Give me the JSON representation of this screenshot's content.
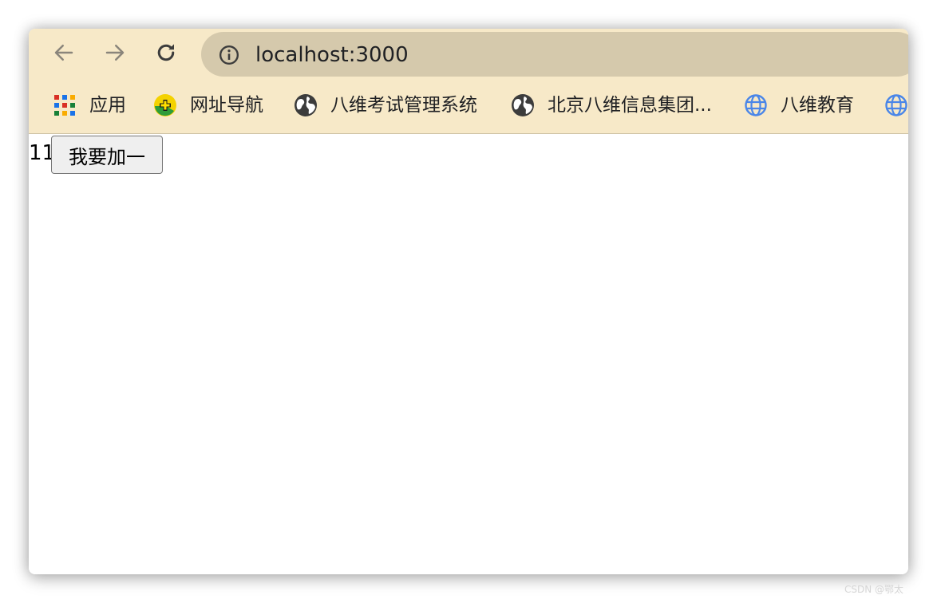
{
  "browser": {
    "url": "localhost:3000",
    "icons": {
      "back": "arrow-left-icon",
      "forward": "arrow-right-icon",
      "reload": "reload-icon",
      "site_info": "info-icon"
    },
    "colors": {
      "toolbar_bg": "#f7e9c8",
      "omnibox_bg": "#d5c9ac"
    }
  },
  "bookmarks": [
    {
      "label": "应用",
      "icon": "apps-grid-icon"
    },
    {
      "label": "网址导航",
      "icon": "navigation-plus-icon"
    },
    {
      "label": "八维考试管理系统",
      "icon": "globe-icon"
    },
    {
      "label": "北京八维信息集团...",
      "icon": "globe-icon"
    },
    {
      "label": "八维教育",
      "icon": "globe-outline-icon"
    },
    {
      "label": "",
      "icon": "globe-outline-icon"
    }
  ],
  "page": {
    "count": "11",
    "button_label": "我要加一"
  },
  "watermark": "CSDN @鄂太"
}
